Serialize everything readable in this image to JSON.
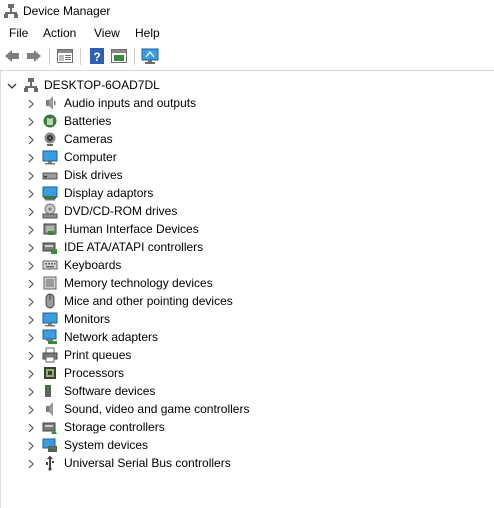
{
  "window": {
    "title": "Device Manager"
  },
  "menu": [
    "File",
    "Action",
    "View",
    "Help"
  ],
  "toolbar": {
    "buttons": [
      "back-arrow-icon",
      "forward-arrow-icon",
      "properties-icon",
      "help-icon",
      "show-hidden-icon",
      "monitor-scan-icon"
    ]
  },
  "tree": {
    "root": "DESKTOP-6OAD7DL",
    "items": [
      {
        "label": "Audio inputs and outputs",
        "icon": "speaker-icon"
      },
      {
        "label": "Batteries",
        "icon": "battery-icon"
      },
      {
        "label": "Cameras",
        "icon": "camera-icon"
      },
      {
        "label": "Computer",
        "icon": "computer-icon"
      },
      {
        "label": "Disk drives",
        "icon": "disk-drive-icon"
      },
      {
        "label": "Display adaptors",
        "icon": "display-adapter-icon"
      },
      {
        "label": "DVD/CD-ROM drives",
        "icon": "dvd-drive-icon"
      },
      {
        "label": "Human Interface Devices",
        "icon": "hid-icon"
      },
      {
        "label": "IDE ATA/ATAPI controllers",
        "icon": "ide-controller-icon"
      },
      {
        "label": "Keyboards",
        "icon": "keyboard-icon"
      },
      {
        "label": "Memory technology devices",
        "icon": "memory-icon"
      },
      {
        "label": "Mice and other pointing devices",
        "icon": "mouse-icon"
      },
      {
        "label": "Monitors",
        "icon": "monitor-icon"
      },
      {
        "label": "Network adapters",
        "icon": "network-adapter-icon"
      },
      {
        "label": "Print queues",
        "icon": "printer-icon"
      },
      {
        "label": "Processors",
        "icon": "processor-icon"
      },
      {
        "label": "Software devices",
        "icon": "software-device-icon"
      },
      {
        "label": "Sound, video and game controllers",
        "icon": "sound-controller-icon"
      },
      {
        "label": "Storage controllers",
        "icon": "storage-controller-icon"
      },
      {
        "label": "System devices",
        "icon": "system-devices-icon"
      },
      {
        "label": "Universal Serial Bus controllers",
        "icon": "usb-icon"
      }
    ]
  }
}
